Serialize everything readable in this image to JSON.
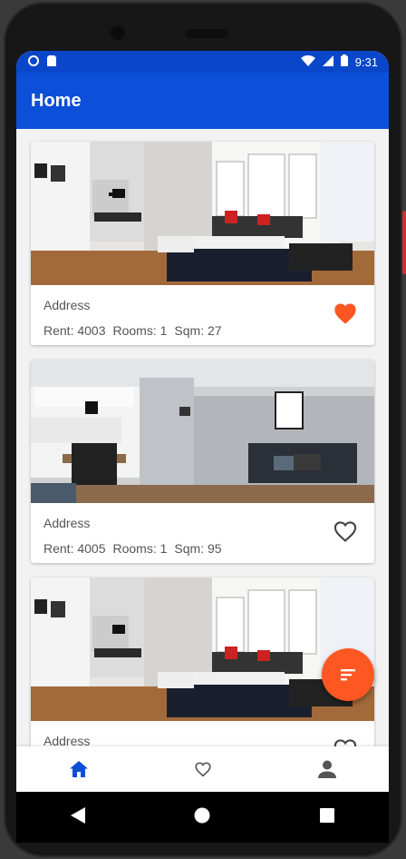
{
  "statusbar": {
    "time": "9:31"
  },
  "appbar": {
    "title": "Home"
  },
  "listings": [
    {
      "address": "Address",
      "rent": "Rent: 4003",
      "rooms": "Rooms: 1",
      "sqm": "Sqm: 27",
      "favorited": true,
      "photo": "living-room-bright"
    },
    {
      "address": "Address",
      "rent": "Rent: 4005",
      "rooms": "Rooms: 1",
      "sqm": "Sqm: 95",
      "favorited": false,
      "photo": "living-room-gray"
    },
    {
      "address": "Address",
      "favorited": false,
      "photo": "living-room-bright"
    }
  ],
  "fab": {
    "icon": "sort-icon"
  },
  "bottom_nav": [
    {
      "name": "home",
      "icon": "home-icon",
      "active": true
    },
    {
      "name": "favorites",
      "icon": "heart-outline-icon",
      "active": false
    },
    {
      "name": "profile",
      "icon": "person-icon",
      "active": false
    }
  ],
  "colors": {
    "primary": "#0c4fd8",
    "statusbar": "#0a46c9",
    "accent": "#ff5722",
    "favorite": "#ff5722"
  }
}
